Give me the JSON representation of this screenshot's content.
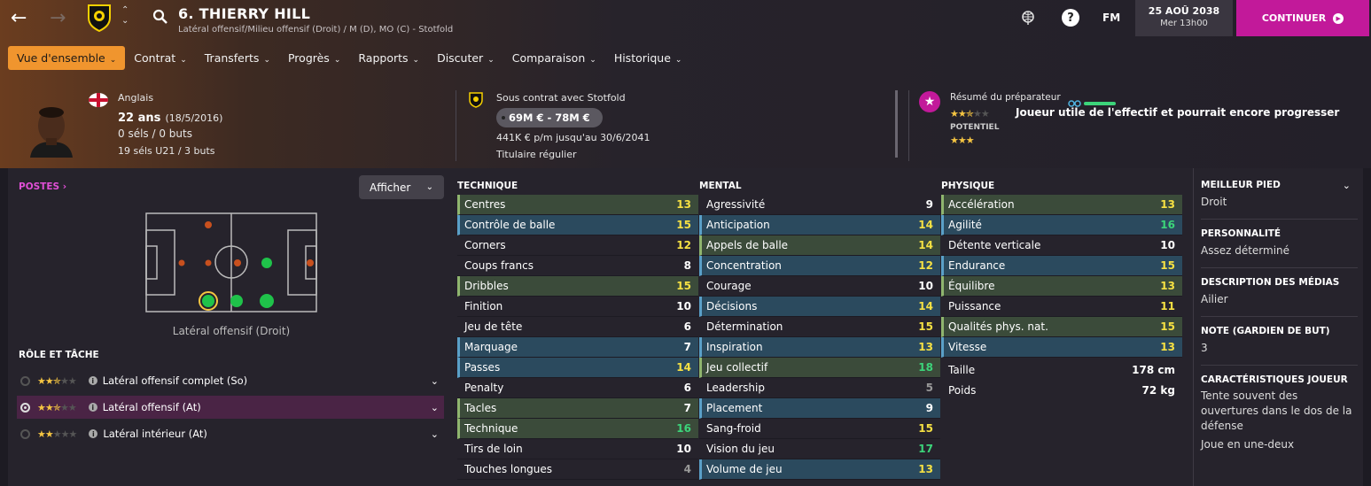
{
  "header": {
    "title": "6. THIERRY HILL",
    "subtitle": "Latéral offensif/Milieu offensif (Droit) / M (D), MO (C) - Stotfold",
    "date": "25 AOÛ 2038",
    "time": "Mer 13h00",
    "continue_label": "CONTINUER",
    "fm_label": "FM"
  },
  "menu": [
    "Vue d'ensemble",
    "Contrat",
    "Transferts",
    "Progrès",
    "Rapports",
    "Discuter",
    "Comparaison",
    "Historique"
  ],
  "player": {
    "nationality": "Anglais",
    "age": "22 ans",
    "dob": "(18/5/2016)",
    "caps": "0 séls / 0 buts",
    "u21": "19 séls U21 / 3 buts"
  },
  "contract": {
    "club_line": "Sous contrat avec Stotfold",
    "value": "69M € - 78M €",
    "wage": "441K € p/m jusqu'au 30/6/2041",
    "status": "Titulaire régulier"
  },
  "coach": {
    "label": "Résumé du préparateur",
    "summary": "Joueur utile de l'effectif et pourrait encore progresser",
    "potential_label": "POTENTIEL",
    "current_stars": 2.5,
    "potential_stars": 3
  },
  "positions": {
    "label": "POSTES",
    "show_button": "Afficher",
    "caption": "Latéral offensif (Droit)"
  },
  "roles": {
    "heading": "RÔLE ET TÂCHE",
    "items": [
      {
        "name": "Latéral offensif complet (So)",
        "stars": 2.5
      },
      {
        "name": "Latéral offensif (At)",
        "stars": 2.5
      },
      {
        "name": "Latéral intérieur (At)",
        "stars": 2
      }
    ]
  },
  "technique": {
    "heading": "TECHNIQUE",
    "rows": [
      {
        "name": "Centres",
        "value": "13"
      },
      {
        "name": "Contrôle de balle",
        "value": "15"
      },
      {
        "name": "Corners",
        "value": "12"
      },
      {
        "name": "Coups francs",
        "value": "8"
      },
      {
        "name": "Dribbles",
        "value": "15"
      },
      {
        "name": "Finition",
        "value": "10"
      },
      {
        "name": "Jeu de tête",
        "value": "6"
      },
      {
        "name": "Marquage",
        "value": "7"
      },
      {
        "name": "Passes",
        "value": "14"
      },
      {
        "name": "Penalty",
        "value": "6"
      },
      {
        "name": "Tacles",
        "value": "7"
      },
      {
        "name": "Technique",
        "value": "16"
      },
      {
        "name": "Tirs de loin",
        "value": "10"
      },
      {
        "name": "Touches longues",
        "value": "4"
      }
    ]
  },
  "mental": {
    "heading": "MENTAL",
    "rows": [
      {
        "name": "Agressivité",
        "value": "9"
      },
      {
        "name": "Anticipation",
        "value": "14"
      },
      {
        "name": "Appels de balle",
        "value": "14"
      },
      {
        "name": "Concentration",
        "value": "12"
      },
      {
        "name": "Courage",
        "value": "10"
      },
      {
        "name": "Décisions",
        "value": "14"
      },
      {
        "name": "Détermination",
        "value": "15"
      },
      {
        "name": "Inspiration",
        "value": "13"
      },
      {
        "name": "Jeu collectif",
        "value": "18"
      },
      {
        "name": "Leadership",
        "value": "5"
      },
      {
        "name": "Placement",
        "value": "9"
      },
      {
        "name": "Sang-froid",
        "value": "15"
      },
      {
        "name": "Vision du jeu",
        "value": "17"
      },
      {
        "name": "Volume de jeu",
        "value": "13"
      }
    ]
  },
  "physique": {
    "heading": "PHYSIQUE",
    "rows": [
      {
        "name": "Accélération",
        "value": "13"
      },
      {
        "name": "Agilité",
        "value": "16"
      },
      {
        "name": "Détente verticale",
        "value": "10"
      },
      {
        "name": "Endurance",
        "value": "15"
      },
      {
        "name": "Équilibre",
        "value": "13"
      },
      {
        "name": "Puissance",
        "value": "11"
      },
      {
        "name": "Qualités phys. nat.",
        "value": "15"
      },
      {
        "name": "Vitesse",
        "value": "13"
      }
    ],
    "height_label": "Taille",
    "height": "178 cm",
    "weight_label": "Poids",
    "weight": "72 kg"
  },
  "side": {
    "foot_h": "MEILLEUR PIED",
    "foot": "Droit",
    "pers_h": "PERSONNALITÉ",
    "pers": "Assez déterminé",
    "media_h": "DESCRIPTION DES MÉDIAS",
    "media": "Ailier",
    "gk_h": "NOTE (GARDIEN DE BUT)",
    "gk": "3",
    "traits_h": "CARACTÉRISTIQUES JOUEUR",
    "trait1": "Tente souvent des ouvertures dans le dos de la défense",
    "trait2": "Joue en une-deux"
  },
  "colors": {
    "accent": "#f0952e",
    "continue": "#c2199a",
    "pink": "#e04fd6",
    "highlight_blue": "#2b4a5e",
    "highlight_green": "#3b4b3a"
  }
}
